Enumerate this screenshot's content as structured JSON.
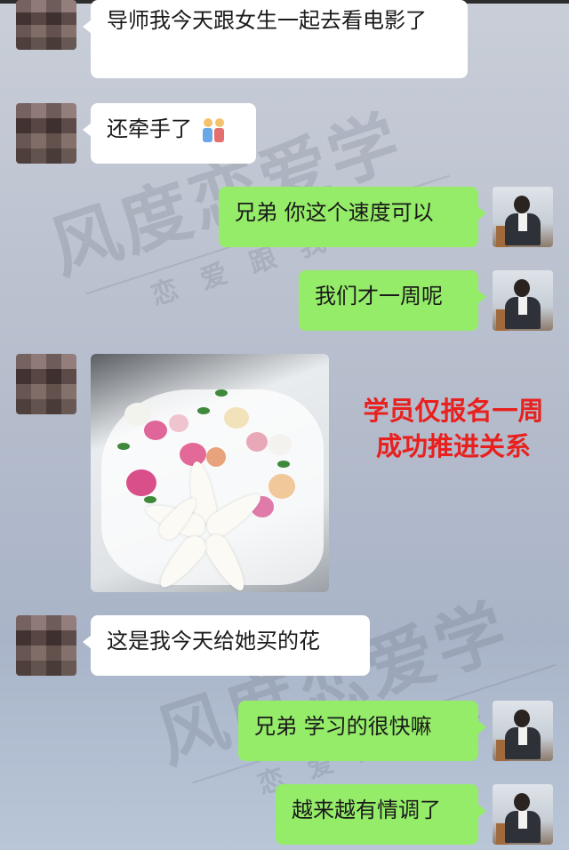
{
  "watermark": {
    "brand": "风度恋爱学",
    "slogan": "恋爱跟我学"
  },
  "messages": [
    {
      "side": "left",
      "text": "导师我今天跟女生一起去看电影了"
    },
    {
      "side": "left",
      "text": "还牵手了",
      "emoji": "couple-holding-hands-icon"
    },
    {
      "side": "right",
      "text": "兄弟 你这个速度可以"
    },
    {
      "side": "right",
      "text": "我们才一周呢"
    },
    {
      "side": "left",
      "type": "image",
      "image": "flower-bouquet-photo"
    },
    {
      "side": "left",
      "text": "这是我今天给她买的花"
    },
    {
      "side": "right",
      "text": "兄弟 学习的很快嘛"
    },
    {
      "side": "right",
      "text": "越来越有情调了"
    }
  ],
  "annotation": {
    "line1": "学员仅报名一周",
    "line2": "成功推进关系",
    "color": "#e8201e"
  },
  "colors": {
    "left_bubble": "#ffffff",
    "right_bubble": "#95ec69"
  }
}
